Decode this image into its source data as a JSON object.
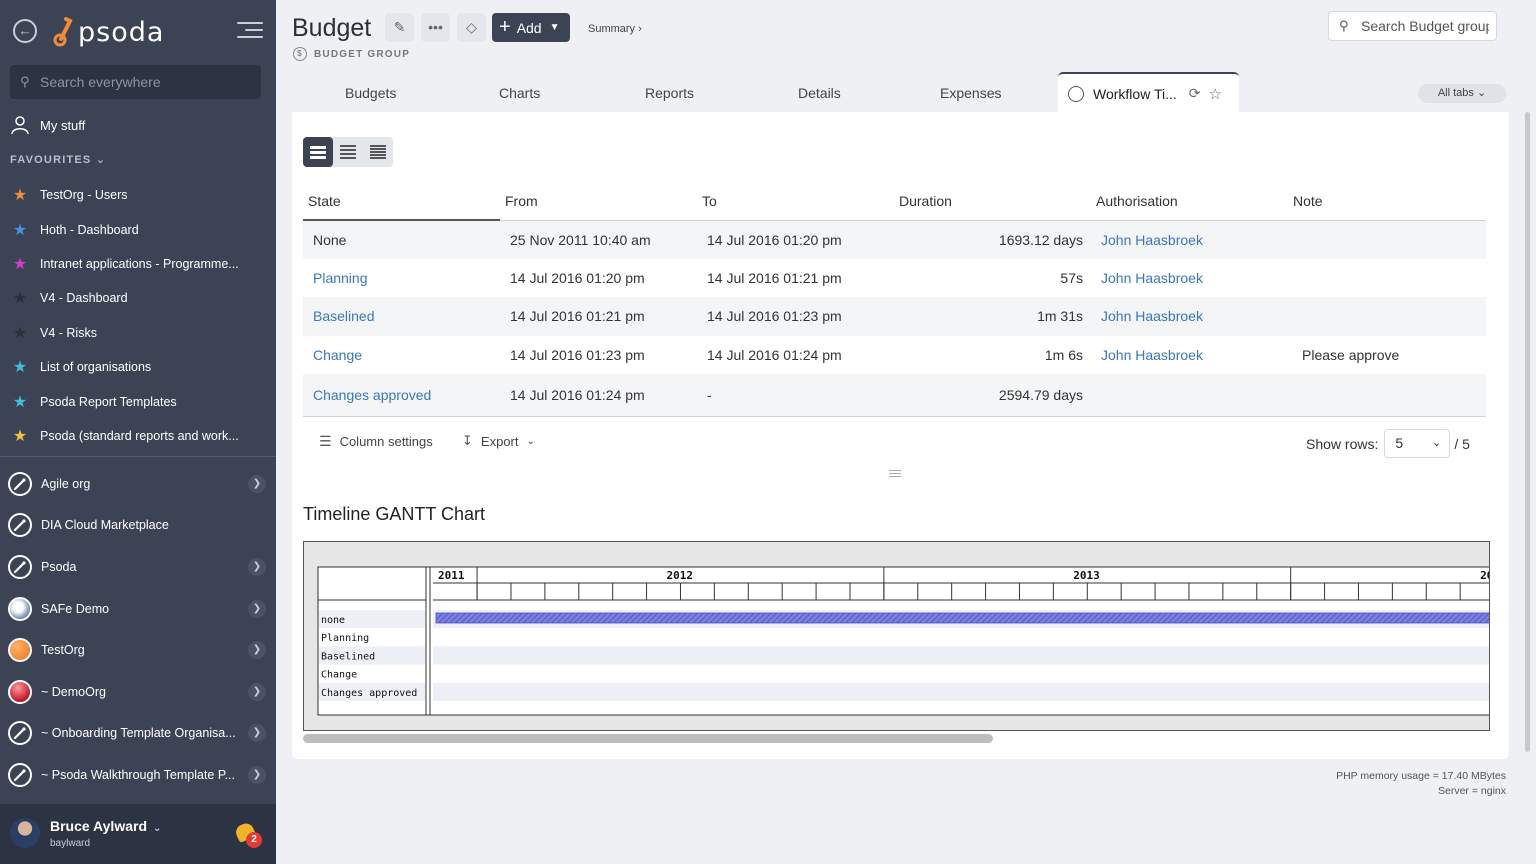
{
  "sidebar": {
    "search_placeholder": "Search everywhere",
    "my_stuff": "My stuff",
    "favourites_header": "FAVOURITES",
    "favourites": [
      {
        "label": "TestOrg - Users",
        "color": "#f28c3a"
      },
      {
        "label": "Hoth - Dashboard",
        "color": "#4a8fe0"
      },
      {
        "label": "Intranet applications - Programme...",
        "color": "#d63bd0"
      },
      {
        "label": "V4 - Dashboard",
        "color": "#2b2f36"
      },
      {
        "label": "V4 - Risks",
        "color": "#2b2f36"
      },
      {
        "label": "List of organisations",
        "color": "#3fc0d8"
      },
      {
        "label": "Psoda Report Templates",
        "color": "#3fc0d8"
      },
      {
        "label": "Psoda (standard reports and work...",
        "color": "#f0c33a"
      }
    ],
    "orgs": [
      {
        "label": "Agile org",
        "icon": "rocket-icon",
        "chevron": true
      },
      {
        "label": "DIA Cloud Marketplace",
        "icon": "rocket-icon",
        "chevron": false
      },
      {
        "label": "Psoda",
        "icon": "rocket-icon",
        "chevron": true
      },
      {
        "label": "SAFe Demo",
        "icon": "globe-icon",
        "chevron": true
      },
      {
        "label": "TestOrg",
        "icon": "orange-circle-icon",
        "chevron": true
      },
      {
        "label": "~ DemoOrg",
        "icon": "red-circle-icon",
        "chevron": true
      },
      {
        "label": "~ Onboarding Template Organisa...",
        "icon": "rocket-icon",
        "chevron": true
      },
      {
        "label": "~ Psoda Walkthrough Template P...",
        "icon": "rocket-icon",
        "chevron": true
      }
    ],
    "user": {
      "name": "Bruce Aylward",
      "login": "baylward",
      "notifications": "2"
    }
  },
  "header": {
    "title": "Budget",
    "subtitle": "BUDGET GROUP",
    "add_label": "Add",
    "summary_link": "Summary ›",
    "search_placeholder": "Search Budget group"
  },
  "tabs": [
    {
      "label": "Budgets"
    },
    {
      "label": "Charts"
    },
    {
      "label": "Reports"
    },
    {
      "label": "Details"
    },
    {
      "label": "Expenses"
    }
  ],
  "active_tab": "Workflow Ti...",
  "all_tabs": "All tabs",
  "table": {
    "columns": [
      "State",
      "From",
      "To",
      "Duration",
      "Authorisation",
      "Note"
    ],
    "rows": [
      {
        "state": "None",
        "state_link": false,
        "from": "25 Nov 2011 10:40 am",
        "to": "14 Jul 2016 01:20 pm",
        "duration": "1693.12 days",
        "auth": "John Haasbroek",
        "note": ""
      },
      {
        "state": "Planning",
        "state_link": true,
        "from": "14 Jul 2016 01:20 pm",
        "to": "14 Jul 2016 01:21 pm",
        "duration": "57s",
        "auth": "John Haasbroek",
        "note": ""
      },
      {
        "state": "Baselined",
        "state_link": true,
        "from": "14 Jul 2016 01:21 pm",
        "to": "14 Jul 2016 01:23 pm",
        "duration": "1m 31s",
        "auth": "John Haasbroek",
        "note": ""
      },
      {
        "state": "Change",
        "state_link": true,
        "from": "14 Jul 2016 01:23 pm",
        "to": "14 Jul 2016 01:24 pm",
        "duration": "1m 6s",
        "auth": "John Haasbroek",
        "note": "Please approve"
      },
      {
        "state": "Changes approved",
        "state_link": true,
        "from": "14 Jul 2016 01:24 pm",
        "to": "-",
        "duration": "2594.79 days",
        "auth": "",
        "note": ""
      }
    ]
  },
  "table_footer": {
    "column_settings": "Column settings",
    "export": "Export",
    "show_rows_label": "Show rows:",
    "show_rows_value": "5",
    "total": "/ 5"
  },
  "gantt": {
    "title": "Timeline GANTT Chart",
    "years": [
      "2011",
      "2012",
      "2013",
      "20"
    ],
    "rows": [
      "none",
      "Planning",
      "Baselined",
      "Change",
      "Changes approved"
    ],
    "bar_color": "#7b7fe0"
  },
  "footer": {
    "memory": "PHP memory usage = 17.40 MBytes",
    "server": "Server = nginx"
  }
}
